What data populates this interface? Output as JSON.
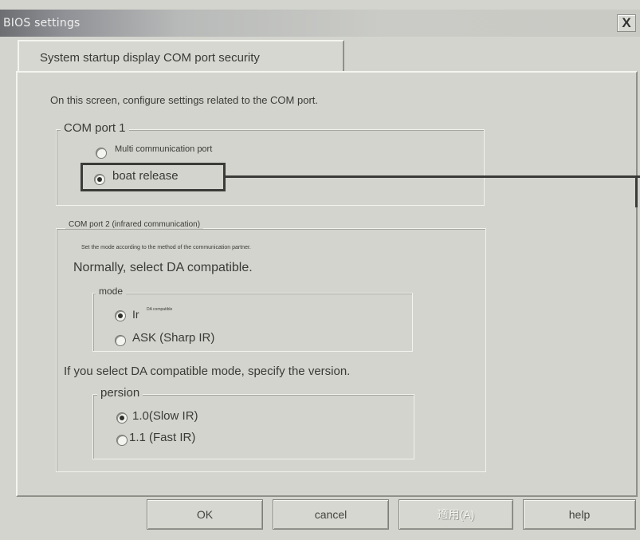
{
  "window": {
    "title": "BIOS settings",
    "close_glyph": "X"
  },
  "tab": {
    "label": "System startup display COM port security"
  },
  "intro_text": "On this screen, configure settings related to the COM port.",
  "com1": {
    "title": "COM port 1",
    "options": [
      {
        "label": "Multi communication port",
        "selected": false
      },
      {
        "label": "boat release",
        "selected": true
      }
    ]
  },
  "com2": {
    "title": "COM port 2 (infrared communication)",
    "note_small": "Set the mode according to the method of the communication partner.",
    "note_large": "Normally, select DA compatible.",
    "mode": {
      "title": "mode",
      "options": [
        {
          "label": "Ir",
          "sublabel": "DA compatible",
          "selected": true
        },
        {
          "label": "ASK (Sharp IR)",
          "selected": false
        }
      ]
    },
    "version_note": "If you select DA compatible mode, specify the version.",
    "version": {
      "title": "persion",
      "options": [
        {
          "label": "1.0(Slow IR)",
          "selected": true
        },
        {
          "label": "1.1 (Fast IR)",
          "selected": false
        }
      ]
    }
  },
  "buttons": {
    "ok": "OK",
    "cancel": "cancel",
    "apply": "適用(A)",
    "help": "help"
  },
  "icons": {
    "close": "close-icon",
    "radio": "radio-icon"
  },
  "colors": {
    "background": "#d3d4cd",
    "titlebar_dark": "#6c6e72",
    "highlight_border": "#3b3c39"
  }
}
